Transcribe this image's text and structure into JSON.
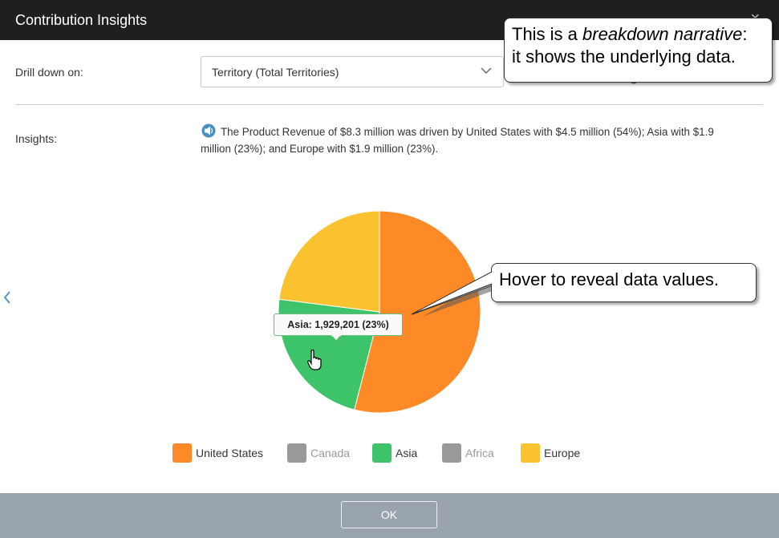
{
  "dialog": {
    "title": "Contribution Insights",
    "close_glyph": "×"
  },
  "drill": {
    "label": "Drill down on:",
    "selected": "Territory (Total Territories)"
  },
  "insights": {
    "label": "Insights:",
    "narrative": "The Product Revenue of $8.3 million was driven by United States with $4.5 million (54%); Asia with $1.9 million (23%); and Europe with $1.9 million (23%)."
  },
  "chart_data": {
    "type": "pie",
    "slices": [
      {
        "name": "United States",
        "value": 4500000,
        "percent": 54,
        "color": "#fe8a27"
      },
      {
        "name": "Asia",
        "value": 1929201,
        "percent": 23,
        "color": "#3dc36a"
      },
      {
        "name": "Europe",
        "value": 1900000,
        "percent": 23,
        "color": "#fbc22f"
      }
    ],
    "legend": [
      {
        "name": "United States",
        "color": "#fe8a27",
        "enabled": true
      },
      {
        "name": "Canada",
        "color": "#999999",
        "enabled": false
      },
      {
        "name": "Asia",
        "color": "#3dc36a",
        "enabled": true
      },
      {
        "name": "Africa",
        "color": "#999999",
        "enabled": false
      },
      {
        "name": "Europe",
        "color": "#fbc22f",
        "enabled": true
      }
    ],
    "tooltip": "Asia: 1,929,201 (23%)"
  },
  "callouts": {
    "narrative_prefix": "This is a ",
    "narrative_em": "breakdown narrative",
    "narrative_suffix": ":",
    "narrative_line2": "it shows the underlying data.",
    "hover": "Hover to reveal data values."
  },
  "footer": {
    "ok_label": "OK"
  },
  "icons": {
    "close": "close-icon",
    "chevron": "chevron-down-icon",
    "speaker": "speaker-icon",
    "nav_left": "chevron-left-icon",
    "cursor": "hand-pointer-icon"
  },
  "colors": {
    "titlebar": "#1f1f1f",
    "footer": "#9aa4ae",
    "accent_blue": "#4a90c4",
    "disabled_text": "#999999"
  }
}
